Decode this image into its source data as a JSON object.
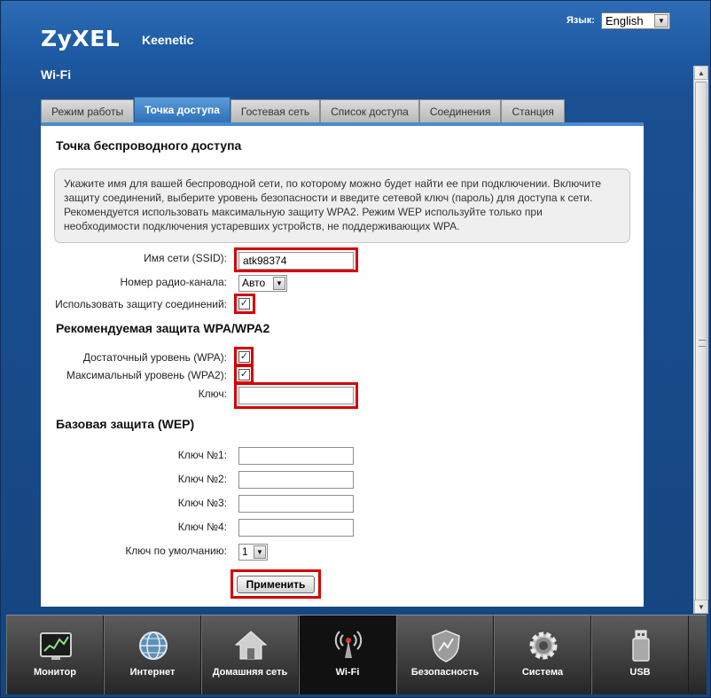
{
  "header": {
    "logo": "ZyXEL",
    "model": "Keenetic",
    "language_label": "Язык:",
    "language_value": "English",
    "page_title": "Wi-Fi"
  },
  "tabs": [
    {
      "label": "Режим работы",
      "active": false
    },
    {
      "label": "Точка доступа",
      "active": true
    },
    {
      "label": "Гостевая сеть",
      "active": false
    },
    {
      "label": "Список доступа",
      "active": false
    },
    {
      "label": "Соединения",
      "active": false
    },
    {
      "label": "Станция",
      "active": false
    }
  ],
  "content": {
    "section_title": "Точка беспроводного доступа",
    "info_text": "Укажите имя для вашей беспроводной сети, по которому можно будет найти ее при подключении. Включите защиту соединений, выберите уровень безопасности и введите сетевой ключ (пароль) для доступа к сети. Рекомендуется использовать максимальную защиту WPA2. Режим WEP используйте только при необходимости подключения устаревших устройств, не поддерживающих WPA.",
    "ssid_label": "Имя сети (SSID):",
    "ssid_value": "atk98374",
    "channel_label": "Номер радио-канала:",
    "channel_value": "Авто",
    "protection_label": "Использовать защиту соединений:",
    "protection_checked": true,
    "wpa_title": "Рекомендуемая защита WPA/WPA2",
    "wpa_label": "Достаточный уровень (WPA):",
    "wpa_checked": true,
    "wpa2_label": "Максимальный уровень (WPA2):",
    "wpa2_checked": true,
    "key_label": "Ключ:",
    "key_value": "",
    "wep_title": "Базовая защита (WEP)",
    "wep_keys": [
      {
        "label": "Ключ №1:",
        "value": ""
      },
      {
        "label": "Ключ №2:",
        "value": ""
      },
      {
        "label": "Ключ №3:",
        "value": ""
      },
      {
        "label": "Ключ №4:",
        "value": ""
      }
    ],
    "default_key_label": "Ключ по умолчанию:",
    "default_key_value": "1",
    "apply_label": "Применить"
  },
  "taskbar": [
    {
      "label": "Монитор",
      "icon": "monitor-icon",
      "active": false
    },
    {
      "label": "Интернет",
      "icon": "globe-icon",
      "active": false
    },
    {
      "label": "Домашняя сеть",
      "icon": "home-icon",
      "active": false
    },
    {
      "label": "Wi-Fi",
      "icon": "wifi-antenna-icon",
      "active": true
    },
    {
      "label": "Безопасность",
      "icon": "shield-icon",
      "active": false
    },
    {
      "label": "Система",
      "icon": "gear-icon",
      "active": false
    },
    {
      "label": "USB",
      "icon": "usb-icon",
      "active": false
    }
  ],
  "colors": {
    "accent": "#2f71b8",
    "highlight": "#d60000",
    "background": "#1d5aa3"
  }
}
